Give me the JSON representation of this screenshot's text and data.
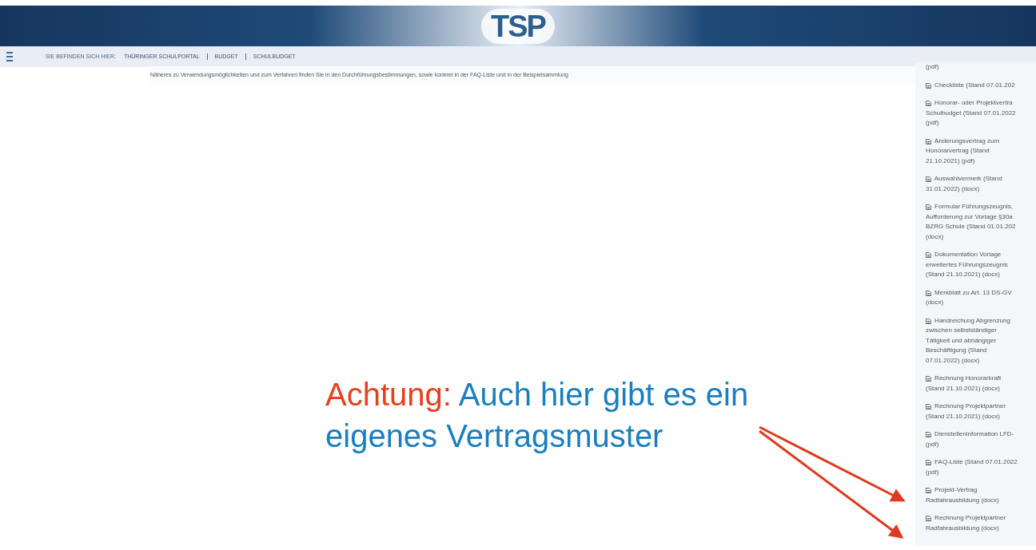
{
  "header": {
    "logo": "TSP"
  },
  "breadcrumb": {
    "label": "SIE BEFINDEN SICH HIER:",
    "items": [
      "THÜRINGER SCHULPORTAL",
      "BUDGET",
      "SCHULBUDGET"
    ]
  },
  "intro": "Näheres zu Verwendungsmöglichkeiten und zum Verfahren finden Sie in den Durchführungsbestimmungen, sowie konkret in der FAQ-Liste und in der Beispielsammlung",
  "downloads": [
    {
      "kind": "continuation",
      "lines": [
        "(pdf)"
      ]
    },
    {
      "kind": "file",
      "lines": [
        "Checkliste (Stand 07.01.202"
      ]
    },
    {
      "kind": "file",
      "lines": [
        "Honorar- oder Projektvertra",
        "Schulbudget (Stand 07.01.2022",
        "(pdf)"
      ]
    },
    {
      "kind": "file",
      "lines": [
        "Änderungsvertrag zum",
        "Honorarvertrag (Stand",
        "21.10.2021) (pdf)"
      ]
    },
    {
      "kind": "file",
      "lines": [
        "Auswahlvermerk (Stand",
        "31.01.2022) (docx)"
      ]
    },
    {
      "kind": "file",
      "lines": [
        "Formular Führungszeugnis,",
        "Aufforderung zur Vorlage §30a",
        "BZRG Schule (Stand 01.01.202",
        "(docx)"
      ]
    },
    {
      "kind": "file",
      "lines": [
        "Dokumentation Vorlage",
        "erweitertes Führungszeugnis",
        "(Stand 21.10.2021) (docx)"
      ]
    },
    {
      "kind": "file",
      "lines": [
        "Merkblatt zu Art. 13 DS-GV",
        "(docx)"
      ]
    },
    {
      "kind": "file",
      "lines": [
        "Handreichung Abgrenzung",
        "zwischen selbstständiger",
        "Tätigkeit und abhängiger",
        "Beschäftigung (Stand",
        "07.01.2022) (docx)"
      ]
    },
    {
      "kind": "file",
      "lines": [
        "Rechnung Honorarkraft",
        "(Stand 21.10.2021) (docx)"
      ]
    },
    {
      "kind": "file",
      "lines": [
        "Rechnung Projektpartner",
        "(Stand 21.10.2021) (docx)"
      ]
    },
    {
      "kind": "file",
      "lines": [
        "Dienstelleninformation LFD-",
        "(pdf)"
      ]
    },
    {
      "kind": "file",
      "lines": [
        "FAQ-Liste (Stand 07.01.2022",
        "(pdf)"
      ]
    },
    {
      "kind": "file",
      "lines": [
        "Projekt-Vertrag",
        "Radfahrausbildung (docx)"
      ]
    },
    {
      "kind": "file",
      "lines": [
        "Rechnung Projektpartner",
        "Radfahrausbildung (docx)"
      ]
    }
  ],
  "annotation": {
    "label": "Achtung:",
    "text": "Auch hier gibt es ein eigenes Vertragsmuster"
  }
}
